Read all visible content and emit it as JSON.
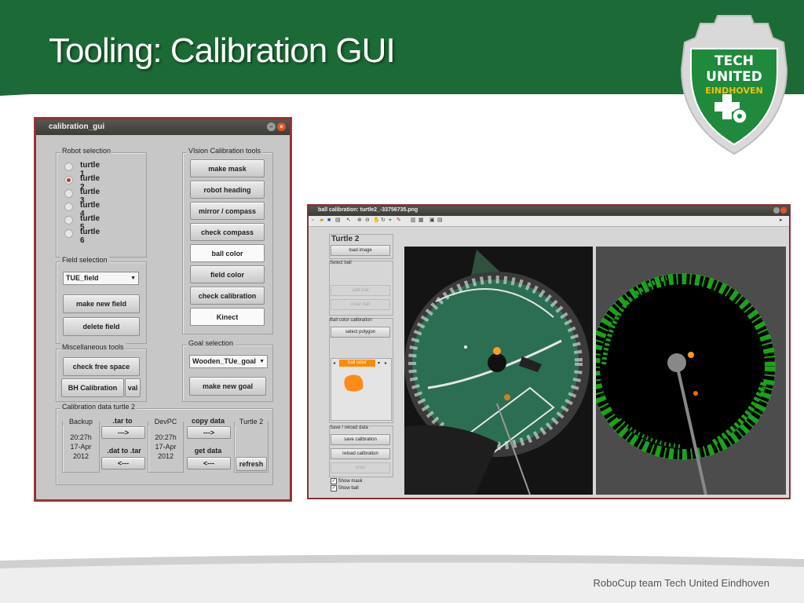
{
  "slide": {
    "title": "Tooling: Calibration GUI",
    "footer": "RoboCup team Tech United Eindhoven"
  },
  "logo": {
    "line1": "TECH",
    "line2": "UNITED",
    "line3": "EINDHOVEN"
  },
  "colors": {
    "brand_green": "#1c6b36",
    "logo_yellow": "#f2c200",
    "ball_orange": "#ff8c00"
  },
  "calibration_gui": {
    "title": "calibration_gui",
    "robot_selection": {
      "label": "Robot selection",
      "robots": [
        "turtle 1",
        "turtle 2",
        "turtle 3",
        "turtle 4",
        "turtle 5",
        "turtle 6"
      ],
      "selected": "turtle 2"
    },
    "vision_tools": {
      "label": "VIsion Calibration tools",
      "buttons": [
        "make mask",
        "robot heading",
        "mirror / compass",
        "check compass",
        "ball color",
        "field color",
        "check calibration",
        "Kinect"
      ]
    },
    "field_selection": {
      "label": "Field selection",
      "field": "TUE_field",
      "make_new_field": "make new field",
      "delete_field": "delete field"
    },
    "misc_tools": {
      "label": "Miscellaneous tools",
      "check_free_space": "check free space",
      "bh_calibration": "BH Calibration",
      "val": "val"
    },
    "goal_selection": {
      "label": "Goal selection",
      "goal": "Wooden_TUe_goal",
      "make_new_goal": "make new goal"
    },
    "calibration_data": {
      "label": "Calibration data turtle 2",
      "backup_label": "Backup",
      "backup_time": "20:27h",
      "backup_date": "17-Apr",
      "backup_year": "2012",
      "tar_to": ".tar to",
      "arrow_right": "--->",
      "dat_to_tar": ".dat to .tar",
      "arrow_left": "<---",
      "devpc_label": "DevPC",
      "devpc_time": "20:27h",
      "devpc_date": "17-Apr",
      "devpc_year": "2012",
      "copy_data": "copy data",
      "get_data": "get data",
      "turtle_label": "Turtle 2",
      "refresh": "refresh"
    }
  },
  "ball_calibration": {
    "title": "ball calibration: turtle2_-33756735.png",
    "turtle": "Turtle 2",
    "load_image": "load image",
    "select_ball_label": "Select ball",
    "add_ball": "add ball",
    "clear_ball": "clear ball",
    "ball_color_calibration_label": "Ball color calibration",
    "select_polygon": "select polygon",
    "ball_color": "ball color",
    "save_reload_label": "Save / reload data",
    "save_calibration": "save calibration",
    "reload_calibration": "reload calibration",
    "undo": "undo",
    "show_mask": "Show mask",
    "show_ball": "Show ball"
  }
}
